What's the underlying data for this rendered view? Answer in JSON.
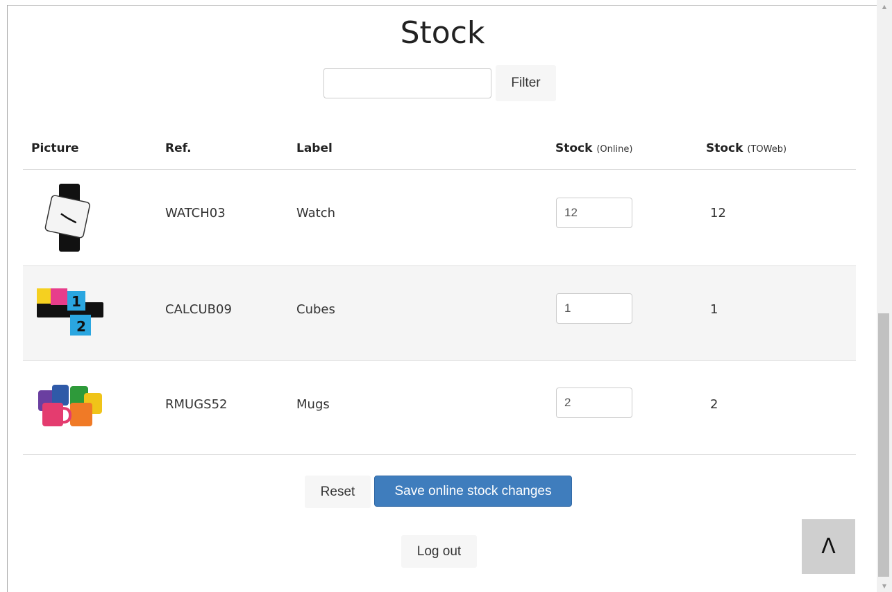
{
  "page": {
    "title": "Stock"
  },
  "filter": {
    "value": "",
    "placeholder": "",
    "button_label": "Filter"
  },
  "table": {
    "headers": {
      "picture": "Picture",
      "ref": "Ref.",
      "label": "Label",
      "stock_online": "Stock",
      "stock_online_note": "(Online)",
      "stock_toweb": "Stock",
      "stock_toweb_note": "(TOWeb)"
    },
    "rows": [
      {
        "picture_icon": "watch-picture",
        "ref": "WATCH03",
        "label": "Watch",
        "stock_online": "12",
        "stock_toweb": "12"
      },
      {
        "picture_icon": "cubes-picture",
        "ref": "CALCUB09",
        "label": "Cubes",
        "stock_online": "1",
        "stock_toweb": "1"
      },
      {
        "picture_icon": "mugs-picture",
        "ref": "RMUGS52",
        "label": "Mugs",
        "stock_online": "2",
        "stock_toweb": "2"
      }
    ]
  },
  "actions": {
    "reset_label": "Reset",
    "save_label": "Save online stock changes",
    "logout_label": "Log out",
    "to_top_label": "Λ"
  },
  "colors": {
    "primary": "#3f7dbd",
    "row_alt": "#f5f5f5",
    "to_top_bg": "#cfcfcf"
  }
}
